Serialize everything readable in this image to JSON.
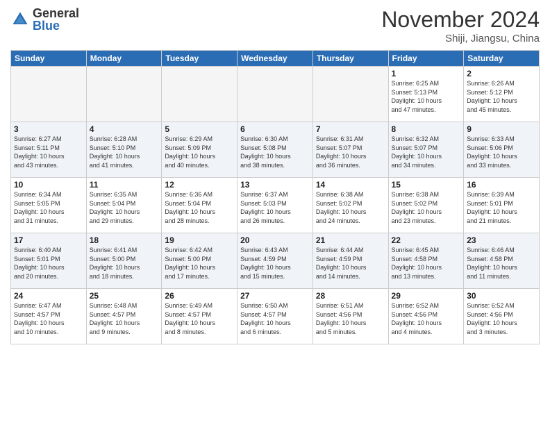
{
  "header": {
    "logo_general": "General",
    "logo_blue": "Blue",
    "month_title": "November 2024",
    "location": "Shiji, Jiangsu, China"
  },
  "weekdays": [
    "Sunday",
    "Monday",
    "Tuesday",
    "Wednesday",
    "Thursday",
    "Friday",
    "Saturday"
  ],
  "weeks": [
    [
      {
        "day": "",
        "info": ""
      },
      {
        "day": "",
        "info": ""
      },
      {
        "day": "",
        "info": ""
      },
      {
        "day": "",
        "info": ""
      },
      {
        "day": "",
        "info": ""
      },
      {
        "day": "1",
        "info": "Sunrise: 6:25 AM\nSunset: 5:13 PM\nDaylight: 10 hours\nand 47 minutes."
      },
      {
        "day": "2",
        "info": "Sunrise: 6:26 AM\nSunset: 5:12 PM\nDaylight: 10 hours\nand 45 minutes."
      }
    ],
    [
      {
        "day": "3",
        "info": "Sunrise: 6:27 AM\nSunset: 5:11 PM\nDaylight: 10 hours\nand 43 minutes."
      },
      {
        "day": "4",
        "info": "Sunrise: 6:28 AM\nSunset: 5:10 PM\nDaylight: 10 hours\nand 41 minutes."
      },
      {
        "day": "5",
        "info": "Sunrise: 6:29 AM\nSunset: 5:09 PM\nDaylight: 10 hours\nand 40 minutes."
      },
      {
        "day": "6",
        "info": "Sunrise: 6:30 AM\nSunset: 5:08 PM\nDaylight: 10 hours\nand 38 minutes."
      },
      {
        "day": "7",
        "info": "Sunrise: 6:31 AM\nSunset: 5:07 PM\nDaylight: 10 hours\nand 36 minutes."
      },
      {
        "day": "8",
        "info": "Sunrise: 6:32 AM\nSunset: 5:07 PM\nDaylight: 10 hours\nand 34 minutes."
      },
      {
        "day": "9",
        "info": "Sunrise: 6:33 AM\nSunset: 5:06 PM\nDaylight: 10 hours\nand 33 minutes."
      }
    ],
    [
      {
        "day": "10",
        "info": "Sunrise: 6:34 AM\nSunset: 5:05 PM\nDaylight: 10 hours\nand 31 minutes."
      },
      {
        "day": "11",
        "info": "Sunrise: 6:35 AM\nSunset: 5:04 PM\nDaylight: 10 hours\nand 29 minutes."
      },
      {
        "day": "12",
        "info": "Sunrise: 6:36 AM\nSunset: 5:04 PM\nDaylight: 10 hours\nand 28 minutes."
      },
      {
        "day": "13",
        "info": "Sunrise: 6:37 AM\nSunset: 5:03 PM\nDaylight: 10 hours\nand 26 minutes."
      },
      {
        "day": "14",
        "info": "Sunrise: 6:38 AM\nSunset: 5:02 PM\nDaylight: 10 hours\nand 24 minutes."
      },
      {
        "day": "15",
        "info": "Sunrise: 6:38 AM\nSunset: 5:02 PM\nDaylight: 10 hours\nand 23 minutes."
      },
      {
        "day": "16",
        "info": "Sunrise: 6:39 AM\nSunset: 5:01 PM\nDaylight: 10 hours\nand 21 minutes."
      }
    ],
    [
      {
        "day": "17",
        "info": "Sunrise: 6:40 AM\nSunset: 5:01 PM\nDaylight: 10 hours\nand 20 minutes."
      },
      {
        "day": "18",
        "info": "Sunrise: 6:41 AM\nSunset: 5:00 PM\nDaylight: 10 hours\nand 18 minutes."
      },
      {
        "day": "19",
        "info": "Sunrise: 6:42 AM\nSunset: 5:00 PM\nDaylight: 10 hours\nand 17 minutes."
      },
      {
        "day": "20",
        "info": "Sunrise: 6:43 AM\nSunset: 4:59 PM\nDaylight: 10 hours\nand 15 minutes."
      },
      {
        "day": "21",
        "info": "Sunrise: 6:44 AM\nSunset: 4:59 PM\nDaylight: 10 hours\nand 14 minutes."
      },
      {
        "day": "22",
        "info": "Sunrise: 6:45 AM\nSunset: 4:58 PM\nDaylight: 10 hours\nand 13 minutes."
      },
      {
        "day": "23",
        "info": "Sunrise: 6:46 AM\nSunset: 4:58 PM\nDaylight: 10 hours\nand 11 minutes."
      }
    ],
    [
      {
        "day": "24",
        "info": "Sunrise: 6:47 AM\nSunset: 4:57 PM\nDaylight: 10 hours\nand 10 minutes."
      },
      {
        "day": "25",
        "info": "Sunrise: 6:48 AM\nSunset: 4:57 PM\nDaylight: 10 hours\nand 9 minutes."
      },
      {
        "day": "26",
        "info": "Sunrise: 6:49 AM\nSunset: 4:57 PM\nDaylight: 10 hours\nand 8 minutes."
      },
      {
        "day": "27",
        "info": "Sunrise: 6:50 AM\nSunset: 4:57 PM\nDaylight: 10 hours\nand 6 minutes."
      },
      {
        "day": "28",
        "info": "Sunrise: 6:51 AM\nSunset: 4:56 PM\nDaylight: 10 hours\nand 5 minutes."
      },
      {
        "day": "29",
        "info": "Sunrise: 6:52 AM\nSunset: 4:56 PM\nDaylight: 10 hours\nand 4 minutes."
      },
      {
        "day": "30",
        "info": "Sunrise: 6:52 AM\nSunset: 4:56 PM\nDaylight: 10 hours\nand 3 minutes."
      }
    ]
  ]
}
